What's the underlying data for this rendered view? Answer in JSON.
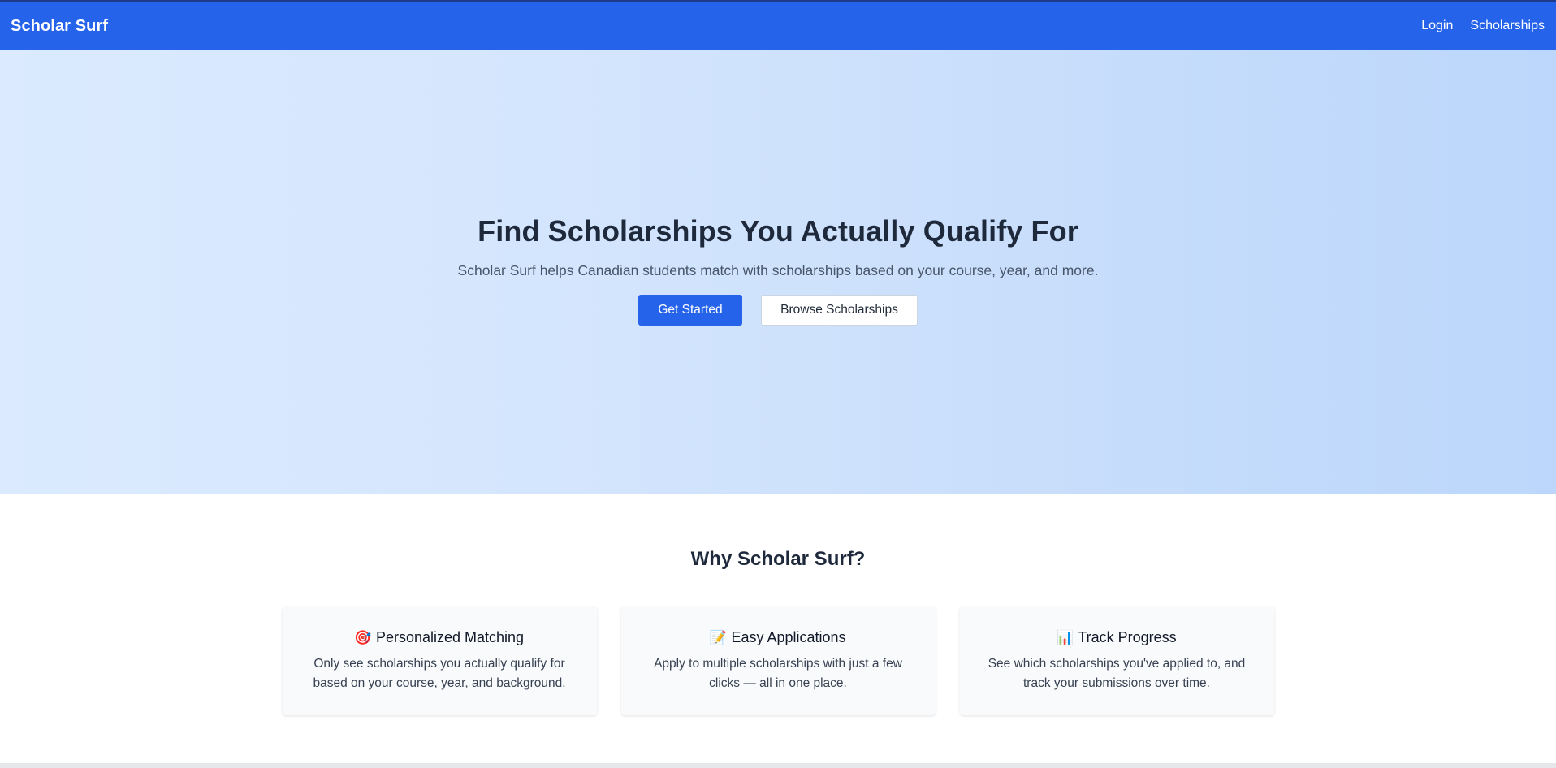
{
  "navbar": {
    "brand": "Scholar Surf",
    "links": [
      {
        "label": "Login"
      },
      {
        "label": "Scholarships"
      }
    ]
  },
  "hero": {
    "title": "Find Scholarships You Actually Qualify For",
    "subtitle": "Scholar Surf helps Canadian students match with scholarships based on your course, year, and more.",
    "primary_button": "Get Started",
    "secondary_button": "Browse Scholarships"
  },
  "features": {
    "title": "Why Scholar Surf?",
    "items": [
      {
        "icon": "🎯",
        "icon_name": "target-icon",
        "title": "Personalized Matching",
        "description": "Only see scholarships you actually qualify for based on your course, year, and background."
      },
      {
        "icon": "📝",
        "icon_name": "memo-icon",
        "title": "Easy Applications",
        "description": "Apply to multiple scholarships with just a few clicks — all in one place."
      },
      {
        "icon": "📊",
        "icon_name": "bar-chart-icon",
        "title": "Track Progress",
        "description": "See which scholarships you've applied to, and track your submissions over time."
      }
    ]
  },
  "colors": {
    "brand_blue": "#2563eb",
    "hero_start": "#dbeafe",
    "hero_end": "#bcd7fb"
  }
}
